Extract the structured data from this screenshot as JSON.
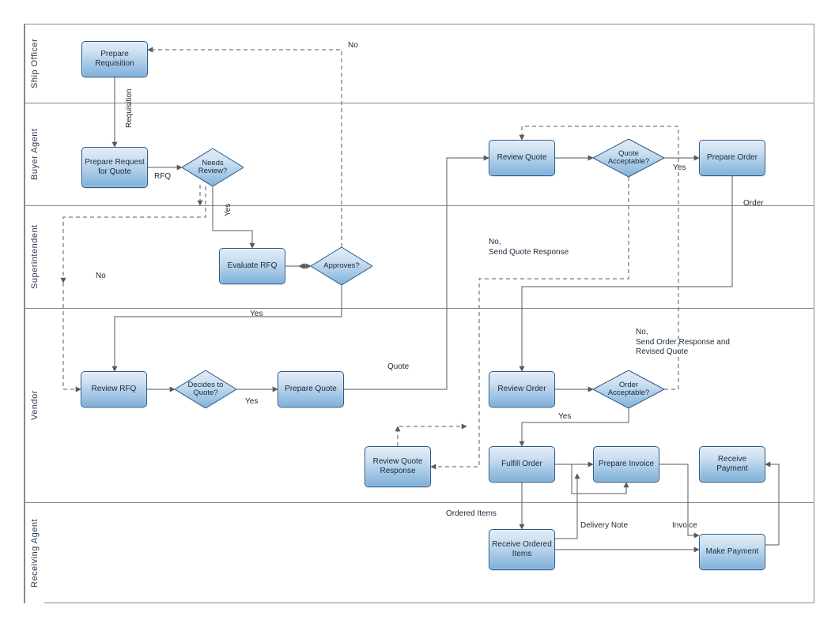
{
  "lanes": {
    "ship_officer": "Ship Officer",
    "buyer_agent": "Buyer Agent",
    "superintendent": "Superintendent",
    "vendor": "Vendor",
    "receiving_agent": "Receiving Agent"
  },
  "proc": {
    "prepare_requisition": "Prepare Requisition",
    "prepare_rfq": "Prepare Request for Quote",
    "review_quote": "Review Quote",
    "prepare_order": "Prepare Order",
    "evaluate_rfq": "Evaluate RFQ",
    "review_rfq": "Review RFQ",
    "prepare_quote": "Prepare Quote",
    "review_order": "Review Order",
    "review_quote_response": "Review Quote Response",
    "fulfill_order": "Fulfill Order",
    "prepare_invoice": "Prepare Invoice",
    "receive_payment": "Receive Payment",
    "receive_ordered_items": "Receive Ordered Items",
    "make_payment": "Make Payment"
  },
  "dec": {
    "needs_review": "Needs Review?",
    "approves": "Approves?",
    "quote_acceptable": "Quote Acceptable?",
    "decides_to_quote": "Decides to Quote?",
    "order_acceptable": "Order Acceptable?"
  },
  "labels": {
    "no": "No",
    "yes": "Yes",
    "requisition": "Requisition",
    "rfq": "RFQ",
    "quote": "Quote",
    "order": "Order",
    "ordered_items": "Ordered Items",
    "delivery_note": "Delivery Note",
    "invoice": "Invoice",
    "no_send_quote_response": "No,\nSend Quote Response",
    "no_send_order_response": "No,\nSend Order Response and\nRevised Quote"
  }
}
